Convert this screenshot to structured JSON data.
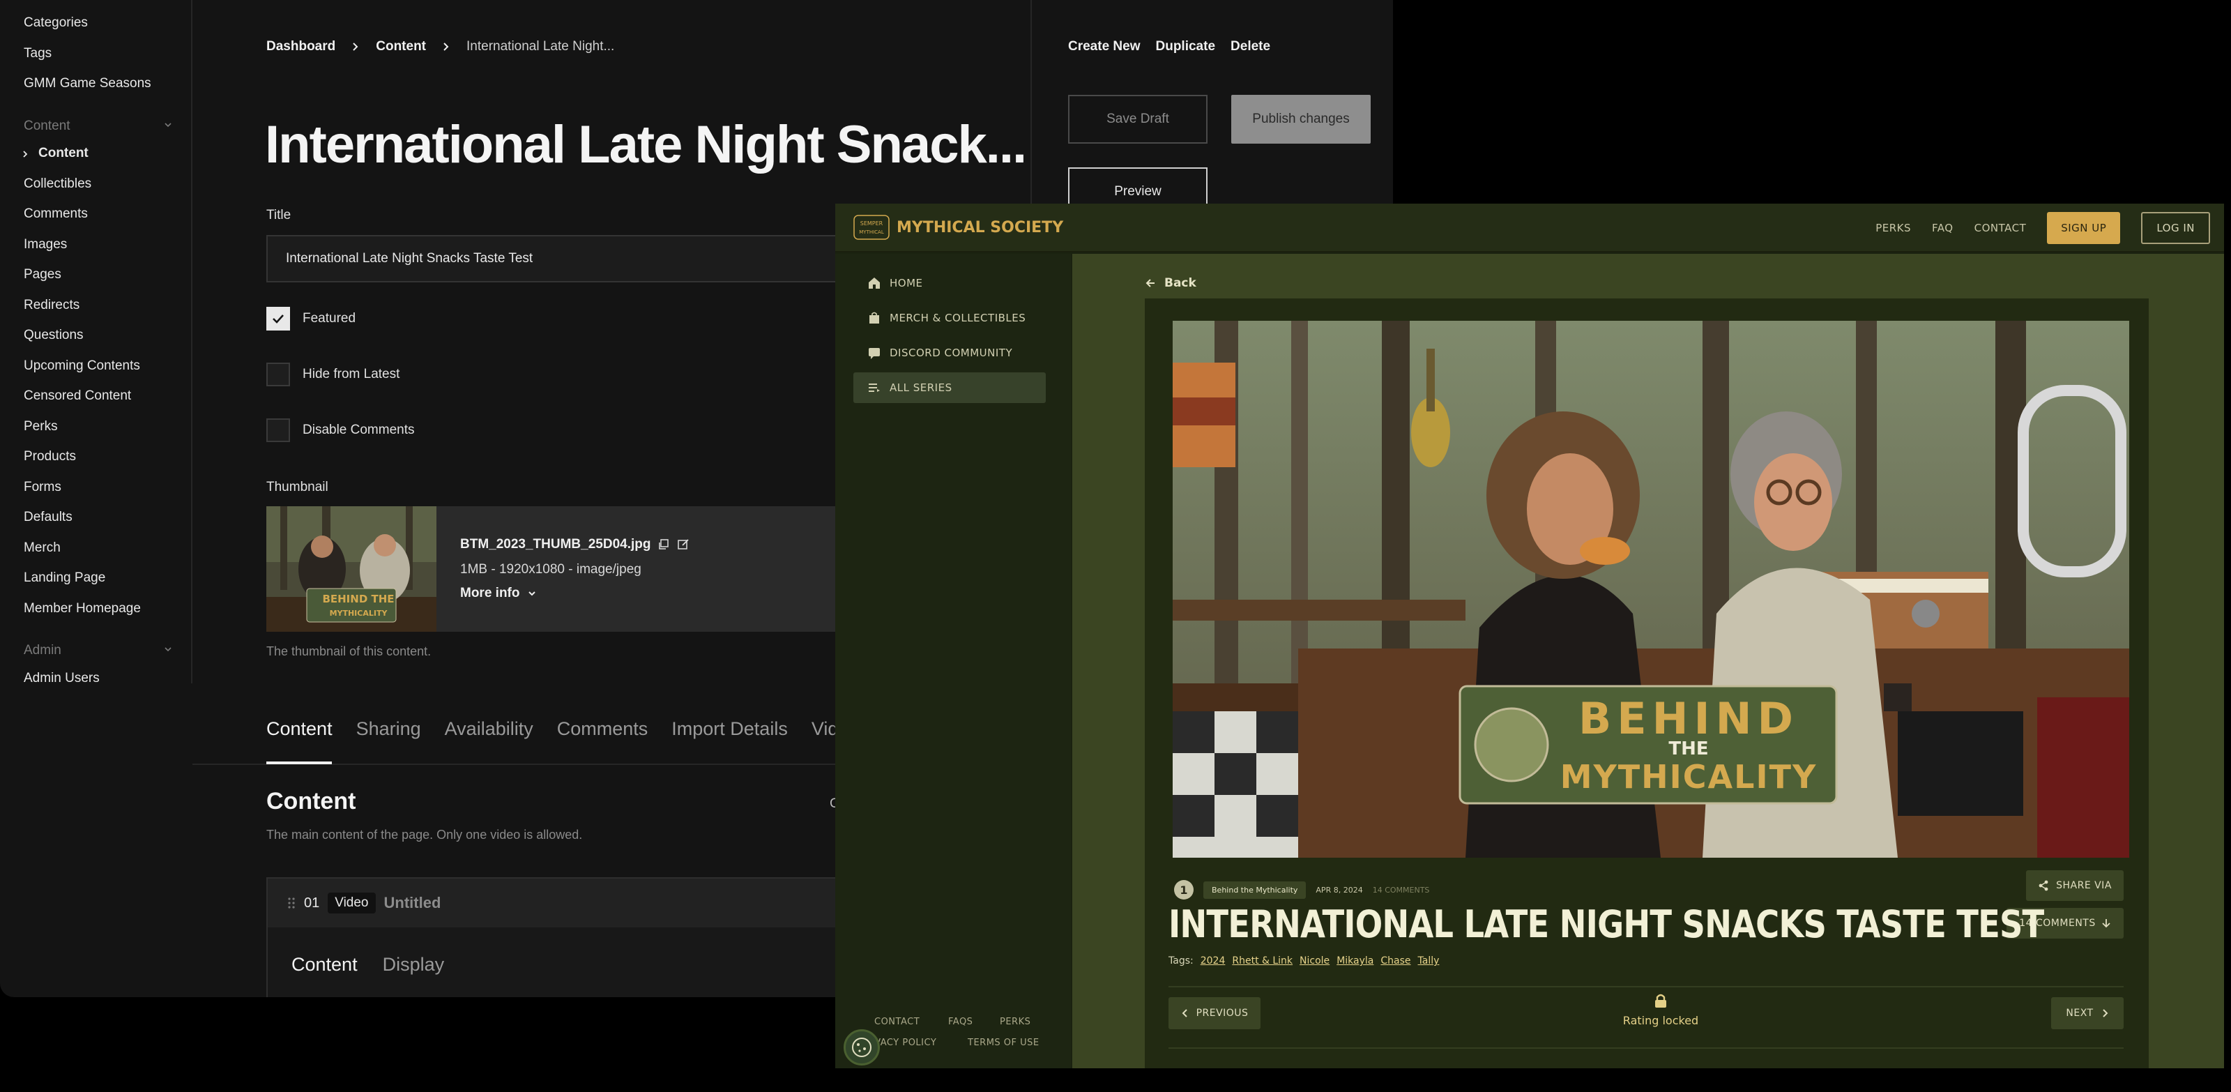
{
  "cms": {
    "sidebar": {
      "items_top": [
        "Categories",
        "Tags",
        "GMM Game Seasons"
      ],
      "section_content": "Content",
      "content_items": [
        "Content",
        "Collectibles",
        "Comments",
        "Images",
        "Pages",
        "Redirects",
        "Questions",
        "Upcoming Contents",
        "Censored Content",
        "Perks",
        "Products",
        "Forms",
        "Defaults",
        "Merch",
        "Landing Page",
        "Member Homepage"
      ],
      "section_admin": "Admin",
      "admin_items": [
        "Admin Users"
      ]
    },
    "breadcrumb": [
      "Dashboard",
      "Content",
      "International Late Night..."
    ],
    "page_title": "International Late Night Snack...",
    "title_label": "Title",
    "title_value": "International Late Night Snacks Taste Test",
    "checkboxes": [
      {
        "label": "Featured",
        "checked": true
      },
      {
        "label": "Hide from Latest",
        "checked": false
      },
      {
        "label": "Disable Comments",
        "checked": false
      }
    ],
    "thumbnail": {
      "label": "Thumbnail",
      "filename": "BTM_2023_THUMB_25D04.jpg",
      "meta": "1MB - 1920x1080 - image/jpeg",
      "more": "More info",
      "help": "The thumbnail of this content.",
      "overlay_text": "BEHIND THE MYTHICALITY"
    },
    "tabs": [
      "Content",
      "Sharing",
      "Availability",
      "Comments",
      "Import Details",
      "Vide"
    ],
    "content_section": {
      "title": "Content",
      "desc": "The main content of the page. Only one video is allowed.",
      "right_char": "C"
    },
    "block": {
      "num": "01",
      "type": "Video",
      "name": "Untitled",
      "tabs": [
        "Content",
        "Display"
      ]
    },
    "actions": {
      "create": "Create New",
      "duplicate": "Duplicate",
      "delete": "Delete",
      "save_draft": "Save Draft",
      "publish": "Publish changes",
      "preview": "Preview"
    }
  },
  "site": {
    "logo_badge": "SEMPER MYTHICAL",
    "logo": "MYTHICAL SOCIETY",
    "nav": [
      "PERKS",
      "FAQ",
      "CONTACT"
    ],
    "signup": "SIGN UP",
    "login": "LOG IN",
    "sidebar": [
      {
        "label": "HOME",
        "icon": "home-icon"
      },
      {
        "label": "MERCH & COLLECTIBLES",
        "icon": "bag-icon"
      },
      {
        "label": "DISCORD COMMUNITY",
        "icon": "chat-icon"
      },
      {
        "label": "ALL SERIES",
        "icon": "list-icon",
        "active": true
      }
    ],
    "footer": [
      "CONTACT",
      "FAQS",
      "PERKS",
      "PRIVACY POLICY",
      "TERMS OF USE"
    ],
    "back": "Back",
    "video_overlay": {
      "top": "BEHIND",
      "mid": "THE",
      "bottom": "MYTHICALITY"
    },
    "episode_num": "1",
    "series": "Behind the Mythicality",
    "date": "APR 8, 2024",
    "comments_count": "14 COMMENTS",
    "share": "SHARE VIA",
    "comments_btn": "14 COMMENTS",
    "title": "INTERNATIONAL LATE NIGHT SNACKS TASTE TEST",
    "tags_label": "Tags:",
    "tags": [
      "2024",
      "Rhett & Link",
      "Nicole",
      "Mikayla",
      "Chase",
      "Tally"
    ],
    "previous": "PREVIOUS",
    "next": "NEXT",
    "locked": "Rating locked"
  },
  "colors": {
    "cms_bg": "#141414",
    "site_gold": "#d6a94e",
    "site_green": "#222a12"
  }
}
